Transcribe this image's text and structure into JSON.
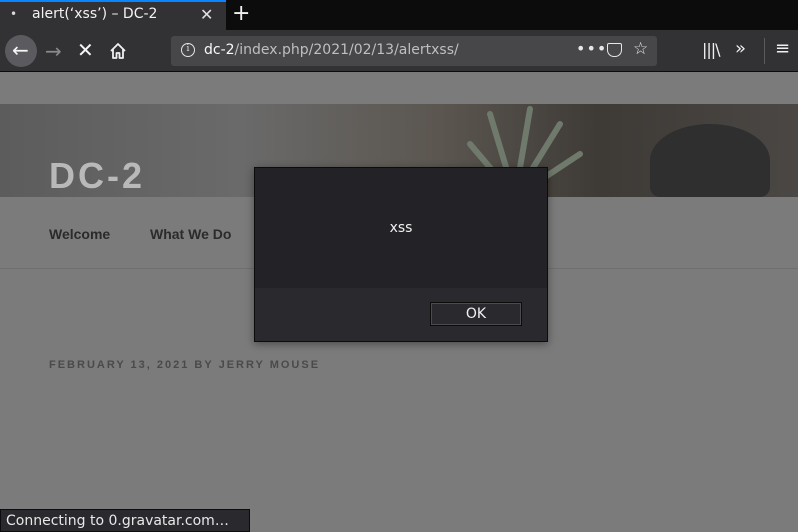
{
  "tab": {
    "title": "alert(‘xss’) – DC-2",
    "close": "✕",
    "new_tab": "+"
  },
  "nav": {
    "back": "←",
    "forward": "→",
    "stop": "✕",
    "url_host": "dc-2",
    "url_path": "/index.php/2021/02/13/alertxss/",
    "more": "•••",
    "star": "☆",
    "library": "|||\\",
    "overflow": "»",
    "menu": "≡"
  },
  "site": {
    "title": "DC-2",
    "menu": [
      "Welcome",
      "What We Do"
    ],
    "post_meta": "FEBRUARY 13, 2021 BY JERRY MOUSE"
  },
  "dialog": {
    "message": "xss",
    "ok_label": "OK"
  },
  "status": {
    "text": "Connecting to 0.gravatar.com…"
  },
  "colors": {
    "tab_accent": "#0a84ff",
    "chrome": "#323234",
    "urlbar": "#474749",
    "dialog": "#2a2a2e"
  }
}
